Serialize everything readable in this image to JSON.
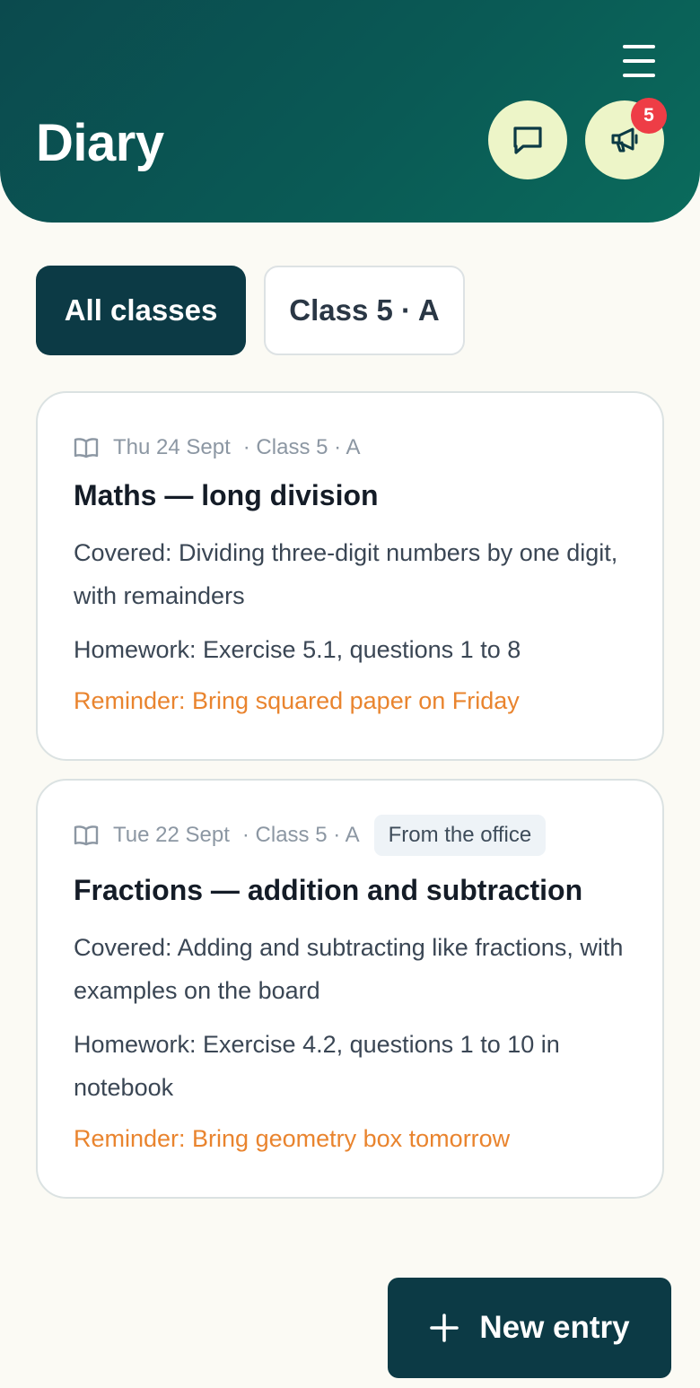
{
  "header": {
    "title": "Diary",
    "menu_icon": "hamburger-menu-icon",
    "messages_icon": "chat-bubble-icon",
    "announcements_icon": "megaphone-icon",
    "announcements_badge": "5",
    "colors": {
      "header_bg": "#0b4a4e",
      "round_button_bg": "#edf5c8",
      "badge_bg": "#ee3d46"
    }
  },
  "filters": [
    {
      "label": "All classes",
      "selected": true
    },
    {
      "label": "Class 5 · A",
      "selected": false
    }
  ],
  "entries": [
    {
      "icon": "open-book-icon",
      "date": "Thu 24 Sept",
      "class": "· Class 5 · A",
      "tag": "",
      "title": "Maths — long division",
      "covered": "Covered: Dividing three-digit numbers by one digit, with remainders",
      "homework": "Homework: Exercise 5.1, questions 1 to 8",
      "reminder": "Reminder: Bring squared paper on Friday"
    },
    {
      "icon": "open-book-icon",
      "date": "Tue 22 Sept",
      "class": "· Class 5 · A",
      "tag": "From the office",
      "title": "Fractions — addition and subtraction",
      "covered": "Covered: Adding and subtracting like fractions, with examples on the board",
      "homework": "Homework: Exercise 4.2, questions 1 to 10 in notebook",
      "reminder": "Reminder: Bring geometry box tomorrow"
    }
  ],
  "fab": {
    "icon": "plus-icon",
    "label": "New entry"
  },
  "colors": {
    "primary": "#0c3a45",
    "reminder": "#e9842e",
    "page_bg": "#fbfaf4"
  }
}
